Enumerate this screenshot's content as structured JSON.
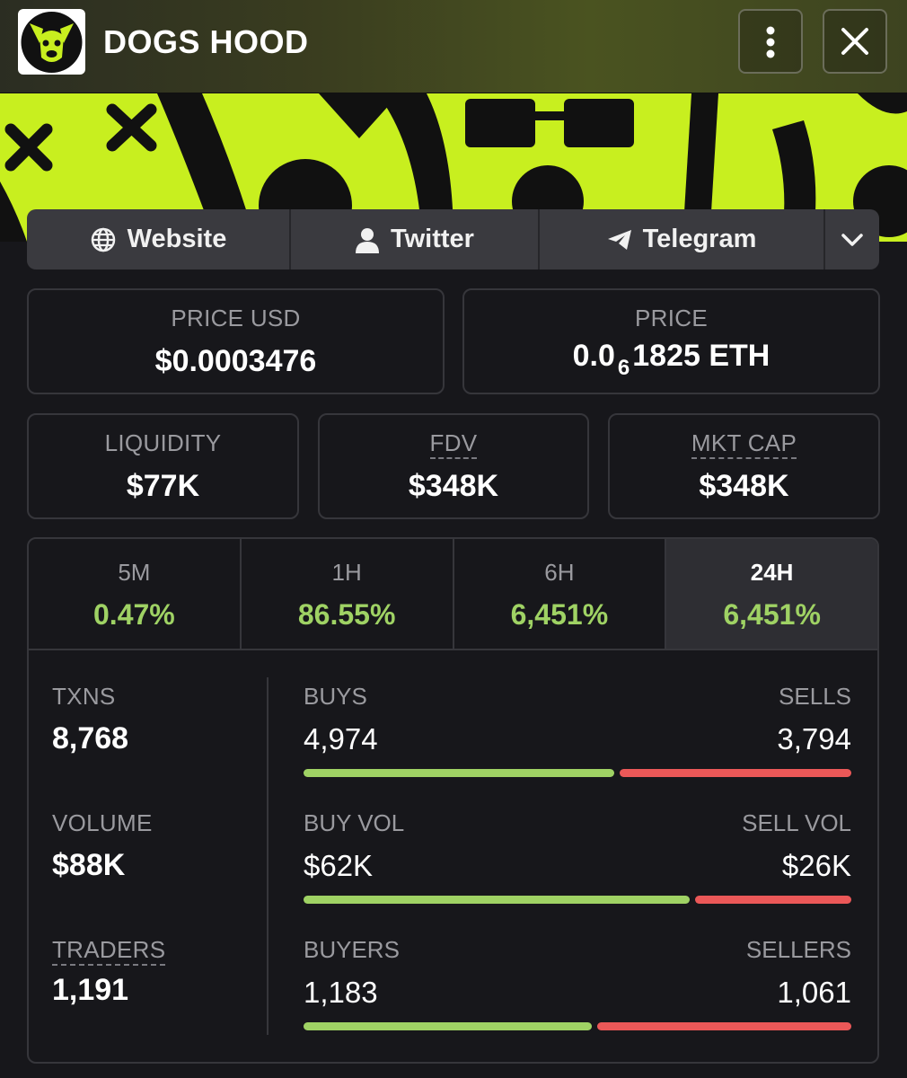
{
  "header": {
    "title": "DOGS HOOD",
    "logo_icon": "dog-face-icon",
    "menu_icon": "more-vertical-icon",
    "close_icon": "close-icon"
  },
  "links": [
    {
      "label": "Website",
      "icon": "globe-icon"
    },
    {
      "label": "Twitter",
      "icon": "user-icon"
    },
    {
      "label": "Telegram",
      "icon": "telegram-icon"
    }
  ],
  "expand_icon": "chevron-down-icon",
  "price_usd": {
    "label": "PRICE USD",
    "value": "$0.0003476"
  },
  "price": {
    "label": "PRICE",
    "prefix": "0.0",
    "subscript": "6",
    "suffix": "1825 ETH"
  },
  "liquidity": {
    "label": "LIQUIDITY",
    "value": "$77K"
  },
  "fdv": {
    "label": "FDV",
    "value": "$348K"
  },
  "mkt_cap": {
    "label": "MKT CAP",
    "value": "$348K"
  },
  "timeframes": [
    {
      "label": "5M",
      "change": "0.47%"
    },
    {
      "label": "1H",
      "change": "86.55%"
    },
    {
      "label": "6H",
      "change": "6,451%"
    },
    {
      "label": "24H",
      "change": "6,451%",
      "active": true
    }
  ],
  "stats": {
    "txns": {
      "label": "TXNS",
      "value": "8,768"
    },
    "volume": {
      "label": "VOLUME",
      "value": "$88K"
    },
    "traders": {
      "label": "TRADERS",
      "value": "1,191"
    },
    "buys": {
      "label": "BUYS",
      "value": "4,974",
      "sells_label": "SELLS",
      "sells_value": "3,794",
      "buy_fraction": 0.567
    },
    "buy_vol": {
      "label": "BUY VOL",
      "value": "$62K",
      "sell_label": "SELL VOL",
      "sell_value": "$26K",
      "buy_fraction": 0.705
    },
    "buyers": {
      "label": "BUYERS",
      "value": "1,183",
      "sellers_label": "SELLERS",
      "sellers_value": "1,061",
      "buy_fraction": 0.527
    }
  },
  "colors": {
    "accent_green": "#9fd264",
    "sell_red": "#eb5858",
    "banner_lime": "#c8ef1f"
  }
}
